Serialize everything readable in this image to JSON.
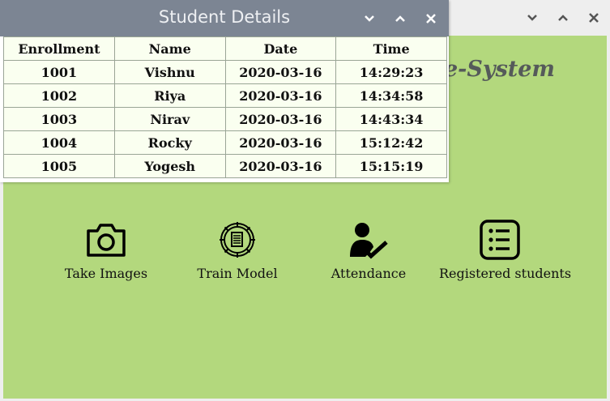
{
  "main_window": {
    "title_fragment": "e-System",
    "tools": [
      {
        "label": "Take Images",
        "icon": "camera-icon"
      },
      {
        "label": "Train Model",
        "icon": "gear-document-icon"
      },
      {
        "label": "Attendance",
        "icon": "person-check-icon"
      },
      {
        "label": "Registered students",
        "icon": "list-icon"
      }
    ]
  },
  "dialog": {
    "title": "Student Details",
    "columns": [
      "Enrollment",
      "Name",
      "Date",
      "Time"
    ],
    "rows": [
      [
        "1001",
        "Vishnu",
        "2020-03-16",
        "14:29:23"
      ],
      [
        "1002",
        "Riya",
        "2020-03-16",
        "14:34:58"
      ],
      [
        "1003",
        "Nirav",
        "2020-03-16",
        "14:43:34"
      ],
      [
        "1004",
        "Rocky",
        "2020-03-16",
        "15:12:42"
      ],
      [
        "1005",
        "Yogesh",
        "2020-03-16",
        "15:15:19"
      ]
    ]
  },
  "colors": {
    "window_bg": "#b3d87d",
    "dialog_titlebar": "#7c8593",
    "table_bg": "#fafff0"
  }
}
